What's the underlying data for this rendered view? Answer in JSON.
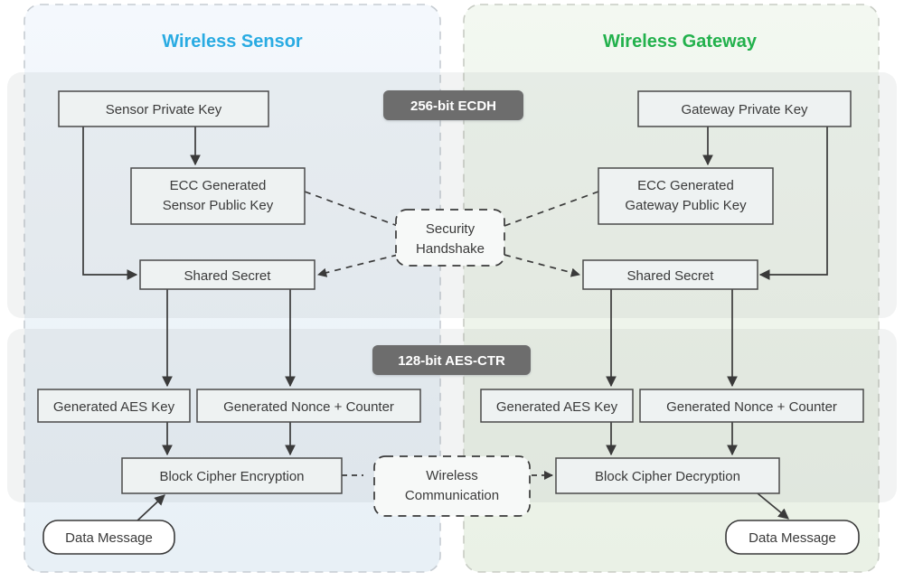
{
  "diagram": {
    "panels": [
      {
        "id": "sensor",
        "title": "Wireless Sensor",
        "title_color": "#29abe2"
      },
      {
        "id": "gateway",
        "title": "Wireless Gateway",
        "title_color": "#22b14c"
      }
    ],
    "bands": [
      {
        "id": "ecdh",
        "badge": "256-bit ECDH"
      },
      {
        "id": "aes",
        "badge": "128-bit AES-CTR"
      }
    ],
    "badge_color": "#6d6d6d",
    "box_fill": "#eef2f2",
    "box_stroke": "#4a4a4a",
    "nodes": {
      "sensor_private_key": "Sensor Private Key",
      "gateway_private_key": "Gateway Private Key",
      "ecc_sensor_public_key_line1": "ECC Generated",
      "ecc_sensor_public_key_line2": "Sensor Public Key",
      "ecc_gateway_public_key_line1": "ECC Generated",
      "ecc_gateway_public_key_line2": "Gateway Public Key",
      "shared_secret_sensor": "Shared Secret",
      "shared_secret_gateway": "Shared Secret",
      "security_handshake_line1": "Security",
      "security_handshake_line2": "Handshake",
      "aes_key_sensor": "Generated AES Key",
      "nonce_counter_sensor": "Generated Nonce + Counter",
      "aes_key_gateway": "Generated AES Key",
      "nonce_counter_gateway": "Generated Nonce + Counter",
      "block_cipher_encryption": "Block Cipher Encryption",
      "block_cipher_decryption": "Block Cipher Decryption",
      "wireless_communication_line1": "Wireless",
      "wireless_communication_line2": "Communication",
      "data_message_sensor": "Data Message",
      "data_message_gateway": "Data Message"
    }
  }
}
